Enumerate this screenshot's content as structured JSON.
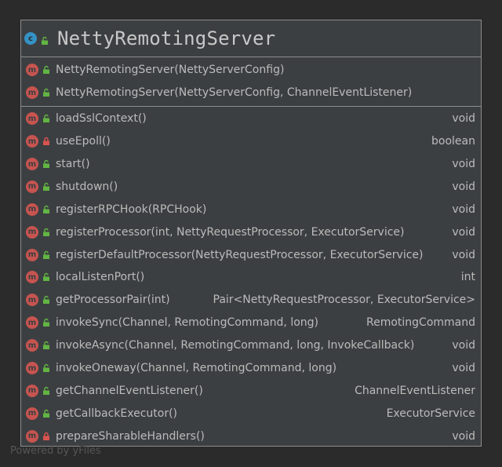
{
  "class": {
    "name": "NettyRemotingServer",
    "badge_letter": "c"
  },
  "constructors": [
    {
      "signature": "NettyRemotingServer(NettyServerConfig)",
      "visibility": "public"
    },
    {
      "signature": "NettyRemotingServer(NettyServerConfig, ChannelEventListener)",
      "visibility": "public"
    }
  ],
  "methods": [
    {
      "signature": "loadSslContext()",
      "return": "void",
      "visibility": "public"
    },
    {
      "signature": "useEpoll()",
      "return": "boolean",
      "visibility": "private"
    },
    {
      "signature": "start()",
      "return": "void",
      "visibility": "public"
    },
    {
      "signature": "shutdown()",
      "return": "void",
      "visibility": "public"
    },
    {
      "signature": "registerRPCHook(RPCHook)",
      "return": "void",
      "visibility": "public"
    },
    {
      "signature": "registerProcessor(int, NettyRequestProcessor, ExecutorService)",
      "return": "void",
      "visibility": "public"
    },
    {
      "signature": "registerDefaultProcessor(NettyRequestProcessor, ExecutorService)",
      "return": "void",
      "visibility": "public"
    },
    {
      "signature": "localListenPort()",
      "return": "int",
      "visibility": "public"
    },
    {
      "signature": "getProcessorPair(int)",
      "return": "Pair<NettyRequestProcessor, ExecutorService>",
      "visibility": "public"
    },
    {
      "signature": "invokeSync(Channel, RemotingCommand, long)",
      "return": "RemotingCommand",
      "visibility": "public"
    },
    {
      "signature": "invokeAsync(Channel, RemotingCommand, long, InvokeCallback)",
      "return": "void",
      "visibility": "public"
    },
    {
      "signature": "invokeOneway(Channel, RemotingCommand, long)",
      "return": "void",
      "visibility": "public"
    },
    {
      "signature": "getChannelEventListener()",
      "return": "ChannelEventListener",
      "visibility": "public"
    },
    {
      "signature": "getCallbackExecutor()",
      "return": "ExecutorService",
      "visibility": "public"
    },
    {
      "signature": "prepareSharableHandlers()",
      "return": "void",
      "visibility": "private"
    }
  ],
  "method_badge_letter": "m",
  "footer": "Powered by yFiles",
  "colors": {
    "public_lock": "#62b543",
    "private_lock": "#d9534f",
    "class_badge": "#3592c4",
    "method_badge": "#c75450"
  }
}
